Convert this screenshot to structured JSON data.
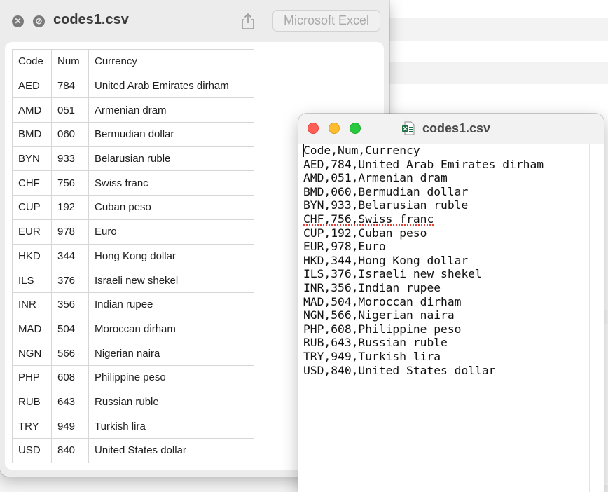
{
  "quicklook": {
    "title": "codes1.csv",
    "close_glyph": "✕",
    "fullscreen_glyph": "⊘",
    "open_with_label": "Microsoft Excel",
    "icons": [
      "close-icon",
      "fullscreen-icon",
      "share-icon"
    ]
  },
  "table": {
    "header": [
      "Code",
      "Num",
      "Currency"
    ],
    "rows": [
      [
        "AED",
        "784",
        "United Arab Emirates dirham"
      ],
      [
        "AMD",
        "051",
        "Armenian dram"
      ],
      [
        "BMD",
        "060",
        "Bermudian dollar"
      ],
      [
        "BYN",
        "933",
        "Belarusian ruble"
      ],
      [
        "CHF",
        "756",
        "Swiss franc"
      ],
      [
        "CUP",
        "192",
        "Cuban peso"
      ],
      [
        "EUR",
        "978",
        "Euro"
      ],
      [
        "HKD",
        "344",
        "Hong Kong dollar"
      ],
      [
        "ILS",
        "376",
        "Israeli new shekel"
      ],
      [
        "INR",
        "356",
        "Indian rupee"
      ],
      [
        "MAD",
        "504",
        "Moroccan dirham"
      ],
      [
        "NGN",
        "566",
        "Nigerian naira"
      ],
      [
        "PHP",
        "608",
        "Philippine peso"
      ],
      [
        "RUB",
        "643",
        "Russian ruble"
      ],
      [
        "TRY",
        "949",
        "Turkish lira"
      ],
      [
        "USD",
        "840",
        "United States dollar"
      ]
    ]
  },
  "textedit": {
    "title": "codes1.csv",
    "icons": [
      "close-button",
      "minimize-button",
      "zoom-button",
      "excel-file-icon"
    ],
    "lines": [
      "Code,Num,Currency",
      "AED,784,United Arab Emirates dirham",
      "AMD,051,Armenian dram",
      "BMD,060,Bermudian dollar",
      "BYN,933,Belarusian ruble",
      "CHF,756,Swiss franc",
      "CUP,192,Cuban peso",
      "EUR,978,Euro",
      "HKD,344,Hong Kong dollar",
      "ILS,376,Israeli new shekel",
      "INR,356,Indian rupee",
      "MAD,504,Moroccan dirham",
      "NGN,566,Nigerian naira",
      "PHP,608,Philippine peso",
      "RUB,643,Russian ruble",
      "TRY,949,Turkish lira",
      "USD,840,United States dollar"
    ],
    "spellcheck_line": 5
  },
  "colors": {
    "traffic_red": "#ff5f57",
    "traffic_yellow": "#febc2e",
    "traffic_green": "#28c840",
    "excel_green": "#1d6f42",
    "spell_underline": "#e0433b"
  }
}
